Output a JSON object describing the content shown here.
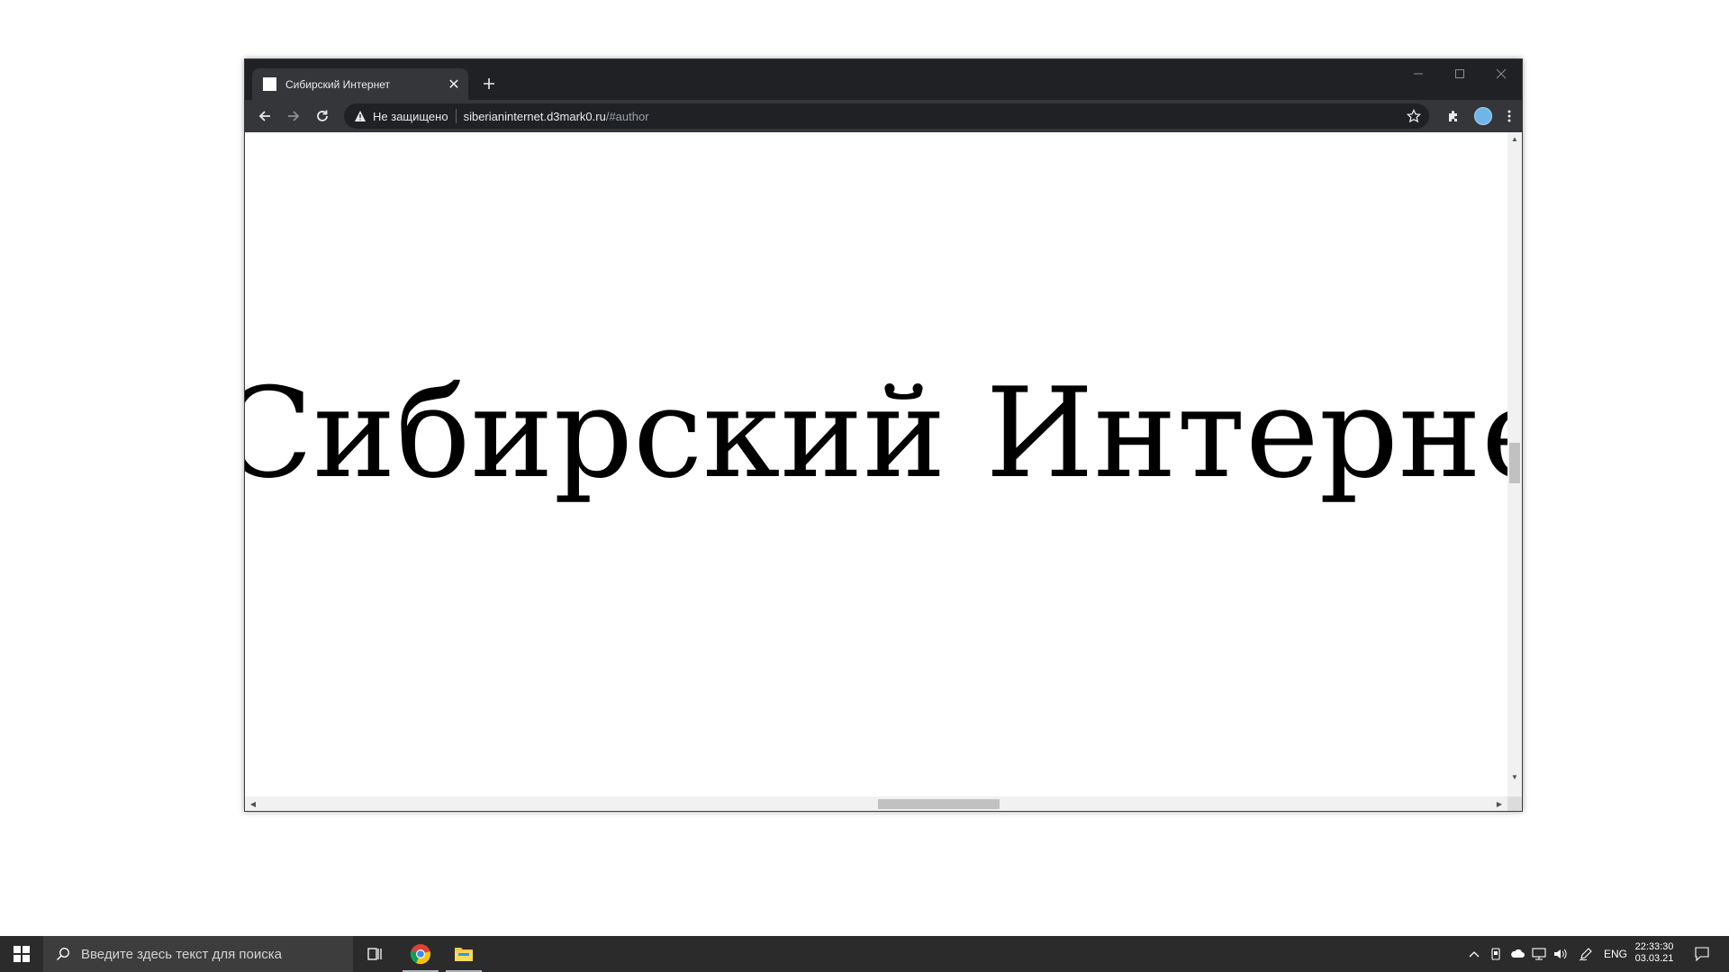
{
  "browser": {
    "tab_title": "Сибирский Интернет",
    "security_label": "Не защищено",
    "url_host": "siberianinternet.d3mark0.ru",
    "url_path": "/#author"
  },
  "page": {
    "headline": "Сибирский Интернет"
  },
  "taskbar": {
    "search_placeholder": "Введите здесь текст для поиска",
    "language": "ENG",
    "time": "22:33:30",
    "date": "03.03.21"
  },
  "icons": {
    "tab_close": "close-icon",
    "new_tab": "plus-icon",
    "back": "arrow-left-icon",
    "forward": "arrow-right-icon",
    "reload": "reload-icon",
    "security": "warning-icon",
    "bookmark": "star-icon",
    "extensions": "puzzle-icon",
    "menu": "kebab-icon"
  },
  "colors": {
    "titlebar": "#202124",
    "toolbar": "#35363a",
    "taskbar": "#2b2b2b",
    "headline": "#000000"
  }
}
